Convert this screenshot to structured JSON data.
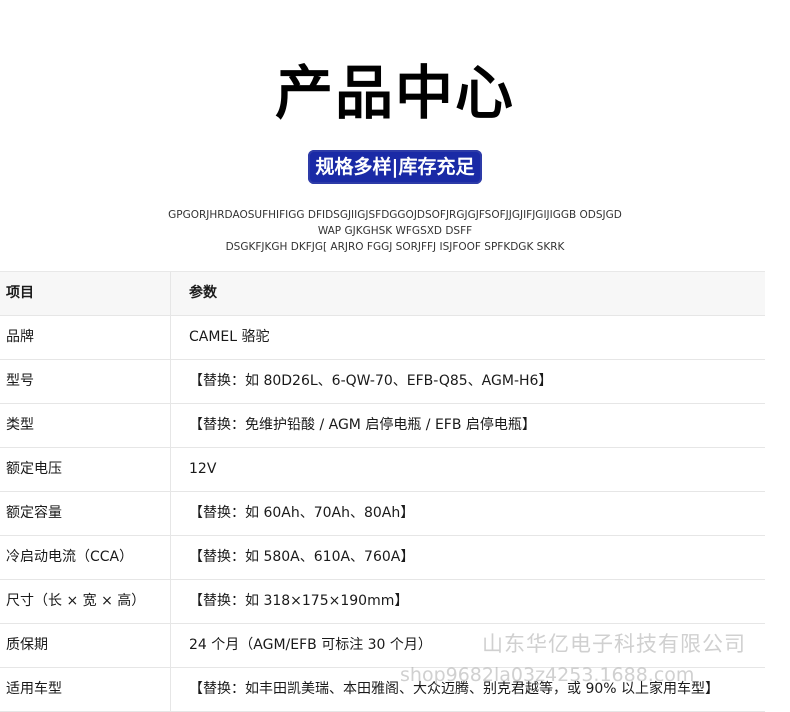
{
  "header": {
    "title": "产品中心",
    "badge": "规格多样|库存充足",
    "badge_color": "#1a2aa6"
  },
  "description": [
    "GPGORJHRDAOSUFHIFIGG DFIDSGJIIGJSFDGGOJDSOFJRGJGJFSOFJJGJIFJGIJIGGB ODSJGD",
    "WAP GJKGHSK  WFGSXD DSFF",
    "DSGKFJKGH DKFJG[  ARJRO  FGGJ SORJFFJ ISJFOOF SPFKDGK  SKRK"
  ],
  "table": {
    "header": {
      "key": "项目",
      "value": "参数"
    },
    "rows": [
      {
        "key": "品牌",
        "value": "CAMEL 骆驼"
      },
      {
        "key": "型号",
        "value": "【替换：如 80D26L、6-QW-70、EFB-Q85、AGM-H6】"
      },
      {
        "key": "类型",
        "value": "【替换：免维护铅酸 / AGM 启停电瓶 / EFB 启停电瓶】"
      },
      {
        "key": "额定电压",
        "value": "12V"
      },
      {
        "key": "额定容量",
        "value": "【替换：如 60Ah、70Ah、80Ah】"
      },
      {
        "key": "冷启动电流（CCA）",
        "value": "【替换：如 580A、610A、760A】"
      },
      {
        "key": "尺寸（长 × 宽 × 高）",
        "value": "【替换：如 318×175×190mm】"
      },
      {
        "key": "质保期",
        "value": "24 个月（AGM/EFB 可标注 30 个月）"
      },
      {
        "key": "适用车型",
        "value": "【替换：如丰田凯美瑞、本田雅阁、大众迈腾、别克君越等，或 90% 以上家用车型】"
      }
    ]
  },
  "watermark": {
    "company": "山东华亿电子科技有限公司",
    "shop": "shop9682la03z4253.1688.com"
  }
}
